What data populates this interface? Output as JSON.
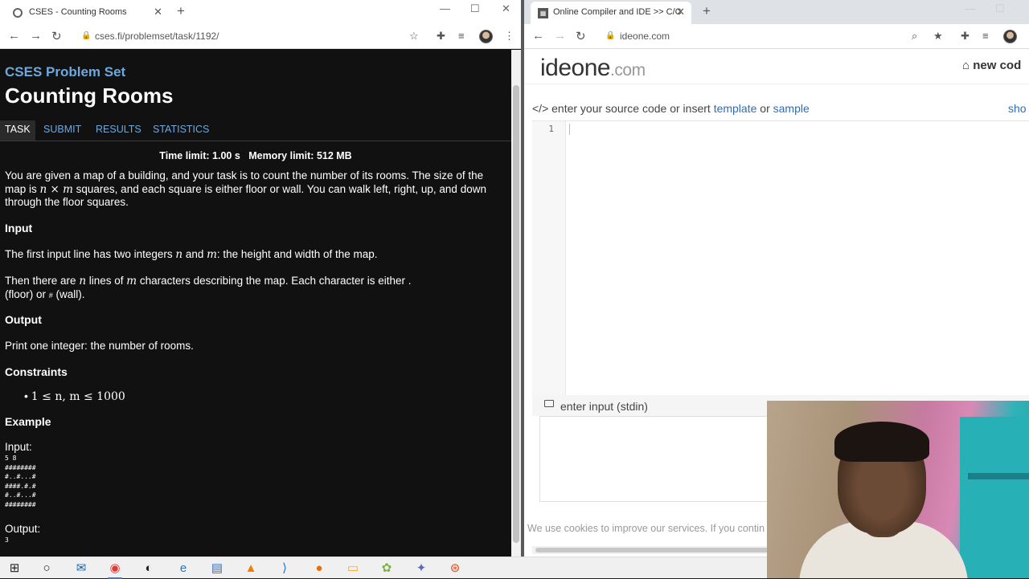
{
  "left_browser": {
    "tab_title": "CSES - Counting Rooms",
    "url": "cses.fi/problemset/task/1192/"
  },
  "cses": {
    "brand": "CSES Problem Set",
    "title": "Counting Rooms",
    "tabs": [
      "TASK",
      "SUBMIT",
      "RESULTS",
      "STATISTICS"
    ],
    "limits": "Time limit: 1.00 s   Memory limit: 512 MB",
    "intro_1": "You are given a map of a building, and your task is to count the number of its rooms. The size of the map is ",
    "intro_math": "n × m",
    "intro_2": " squares, and each square is either floor or wall. You can walk left, right, up, and down through the floor squares.",
    "input_heading": "Input",
    "input_p1_a": "The first input line has two integers ",
    "input_p1_n": "n",
    "input_p1_b": " and ",
    "input_p1_m": "m",
    "input_p1_c": ": the height and width of the map.",
    "input_p2_a": "Then there are ",
    "input_p2_n": "n",
    "input_p2_b": " lines of ",
    "input_p2_m": "m",
    "input_p2_c": " characters describing the map. Each character is either ",
    "input_p2_dot": ".",
    "input_p2_d": "(floor) or ",
    "input_p2_hash": "#",
    "input_p2_e": " (wall).",
    "output_heading": "Output",
    "output_text": "Print one integer: the number of rooms.",
    "constraints_heading": "Constraints",
    "constraint": "1 ≤ n, m ≤ 1000",
    "example_heading": "Example",
    "example_input_label": "Input:",
    "example_input": "5 8\n########\n#..#...#\n####.#.#\n#..#...#\n########",
    "example_output_label": "Output:",
    "example_output": "3"
  },
  "right_browser": {
    "tab_title": "Online Compiler and IDE >> C/C",
    "url": "ideone.com"
  },
  "ideone": {
    "logo_main": "ideone",
    "logo_dot": ".com",
    "new_code": "new cod",
    "editor_prefix": "</>  enter your source code or insert ",
    "template_link": "template",
    "or": " or ",
    "sample_link": "sample",
    "show_link": "sho",
    "line_number": "1",
    "stdin_label": "enter input (stdin)",
    "cookie_text": "We use cookies to improve our services. If you contin"
  },
  "colors": {
    "cses_link": "#6fa8dc",
    "ideone_link": "#2a6ebb"
  },
  "taskbar_icons": [
    "windows-start-icon",
    "cortana-icon",
    "mail-icon",
    "chrome-icon",
    "obs-icon",
    "edge-icon",
    "files-icon",
    "vlc-icon",
    "vscode-icon",
    "firefox-icon",
    "folder-icon",
    "game-icon",
    "network-icon",
    "ubuntu-icon"
  ]
}
